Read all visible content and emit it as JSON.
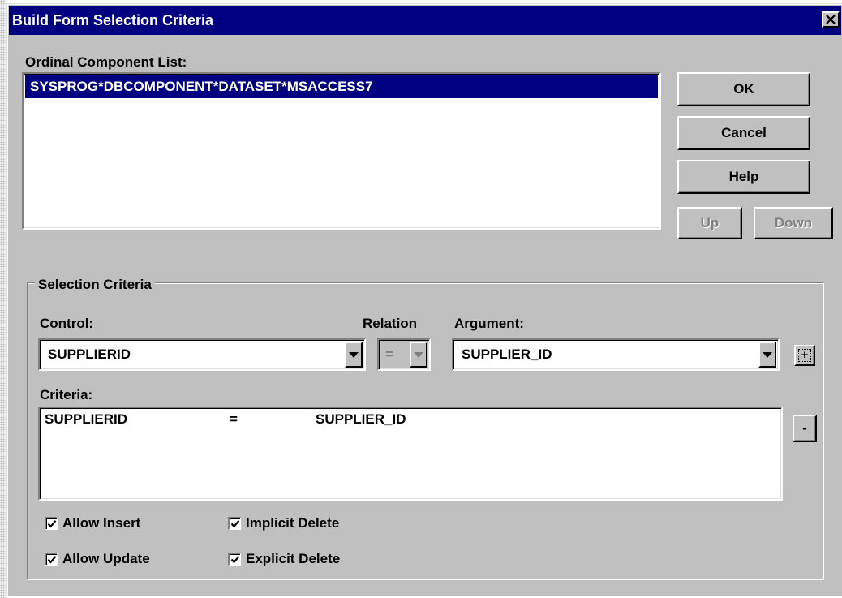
{
  "dialog": {
    "title": "Build Form Selection Criteria",
    "close_icon": "close-x",
    "component_list_label": "Ordinal Component List:",
    "component_list_items": [
      "SYSPROG*DBCOMPONENT*DATASET*MSACCESS7"
    ],
    "buttons": {
      "ok": "OK",
      "cancel": "Cancel",
      "help": "Help",
      "up": "Up",
      "down": "Down"
    }
  },
  "selection_criteria": {
    "group_label": "Selection Criteria",
    "control_label": "Control:",
    "relation_label": "Relation",
    "argument_label": "Argument:",
    "control_value": "SUPPLIERID",
    "relation_value": "=",
    "argument_value": "SUPPLIER_ID",
    "add_button": "+",
    "remove_button": "-",
    "criteria_label": "Criteria:",
    "criteria_rows": [
      {
        "control": "SUPPLIERID",
        "relation": "=",
        "argument": "SUPPLIER_ID"
      }
    ]
  },
  "options": {
    "allow_insert": {
      "label": "Allow Insert",
      "checked": true
    },
    "allow_update": {
      "label": "Allow Update",
      "checked": true
    },
    "implicit_delete": {
      "label": "Implicit Delete",
      "checked": true
    },
    "explicit_delete": {
      "label": "Explicit Delete",
      "checked": true
    }
  },
  "colors": {
    "titlebar": "#000080",
    "face": "#c0c0c0",
    "selection": "#000080"
  }
}
